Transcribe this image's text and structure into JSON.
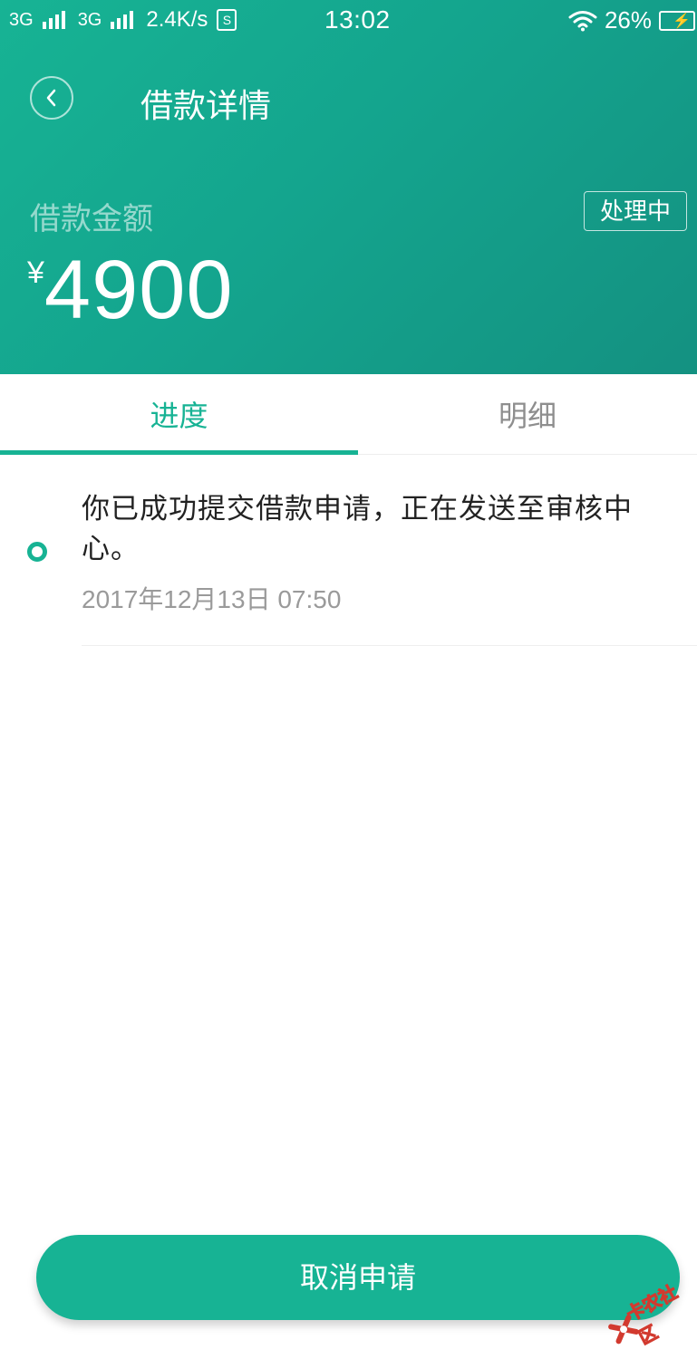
{
  "status_bar": {
    "net1": "3G",
    "net2": "3G",
    "speed": "2.4K/s",
    "sim_letter": "S",
    "time": "13:02",
    "battery": "26%"
  },
  "nav": {
    "title": "借款详情"
  },
  "loan": {
    "amount_label": "借款金额",
    "currency": "¥",
    "amount": "4900",
    "status": "处理中"
  },
  "tabs": [
    {
      "label": "进度",
      "active": true
    },
    {
      "label": "明细",
      "active": false
    }
  ],
  "timeline": [
    {
      "text": "你已成功提交借款申请，正在发送至审核中心。",
      "time": "2017年12月13日 07:50"
    }
  ],
  "actions": {
    "cancel_label": "取消申请"
  },
  "watermark": {
    "text": "卡农社区"
  },
  "colors": {
    "primary": "#17b394",
    "header_end": "#149181",
    "muted_text": "#9a9a9a",
    "inactive_tab": "#8e8e8e"
  }
}
